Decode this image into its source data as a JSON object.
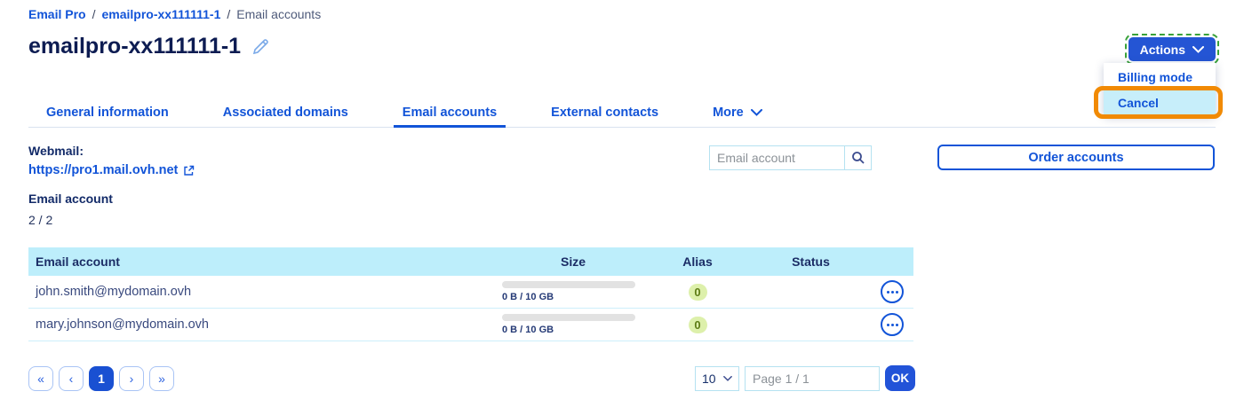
{
  "breadcrumb": {
    "separator": "/",
    "items": [
      {
        "label": "Email Pro"
      },
      {
        "label": "emailpro-xx111111-1"
      },
      {
        "label": "Email accounts"
      }
    ]
  },
  "header": {
    "title": "emailpro-xx111111-1",
    "actions_label": "Actions"
  },
  "actions_menu": {
    "items": [
      {
        "label": "Billing mode"
      },
      {
        "label": "Cancel",
        "highlighted": true
      }
    ]
  },
  "tabs": [
    {
      "label": "General information",
      "active": false
    },
    {
      "label": "Associated domains",
      "active": false
    },
    {
      "label": "Email accounts",
      "active": true
    },
    {
      "label": "External contacts",
      "active": false
    },
    {
      "label": "More",
      "active": false,
      "has_menu": true
    }
  ],
  "info": {
    "webmail_label": "Webmail:",
    "webmail_url": "https://pro1.mail.ovh.net",
    "account_label": "Email account",
    "account_count": "2 / 2"
  },
  "toolbar": {
    "search_placeholder": "Email account",
    "order_button": "Order accounts"
  },
  "table": {
    "columns": [
      "Email account",
      "Size",
      "Alias",
      "Status"
    ],
    "rows": [
      {
        "email": "john.smith@mydomain.ovh",
        "size": "0 B / 10 GB",
        "usage_percent": 0,
        "alias": "0",
        "status": ""
      },
      {
        "email": "mary.johnson@mydomain.ovh",
        "size": "0 B / 10 GB",
        "usage_percent": 0,
        "alias": "0",
        "status": ""
      }
    ]
  },
  "pagination": {
    "first": "«",
    "prev": "‹",
    "current_page": "1",
    "next": "›",
    "last": "»",
    "page_size": "10",
    "page_info": "Page 1 / 1",
    "ok_label": "OK"
  },
  "colors": {
    "primary_blue": "#1254d8",
    "button_blue": "#2455d4",
    "dark_navy": "#0d1c52",
    "table_header_bg": "#bdeefb",
    "menu_highlight_bg": "#c7eefa",
    "annotation_orange": "#f18a04",
    "focus_green_dashed": "#3aa23a",
    "badge_bg": "#ddf0ab",
    "badge_text": "#5d7c15",
    "progress_gray": "#e2e2e2"
  }
}
